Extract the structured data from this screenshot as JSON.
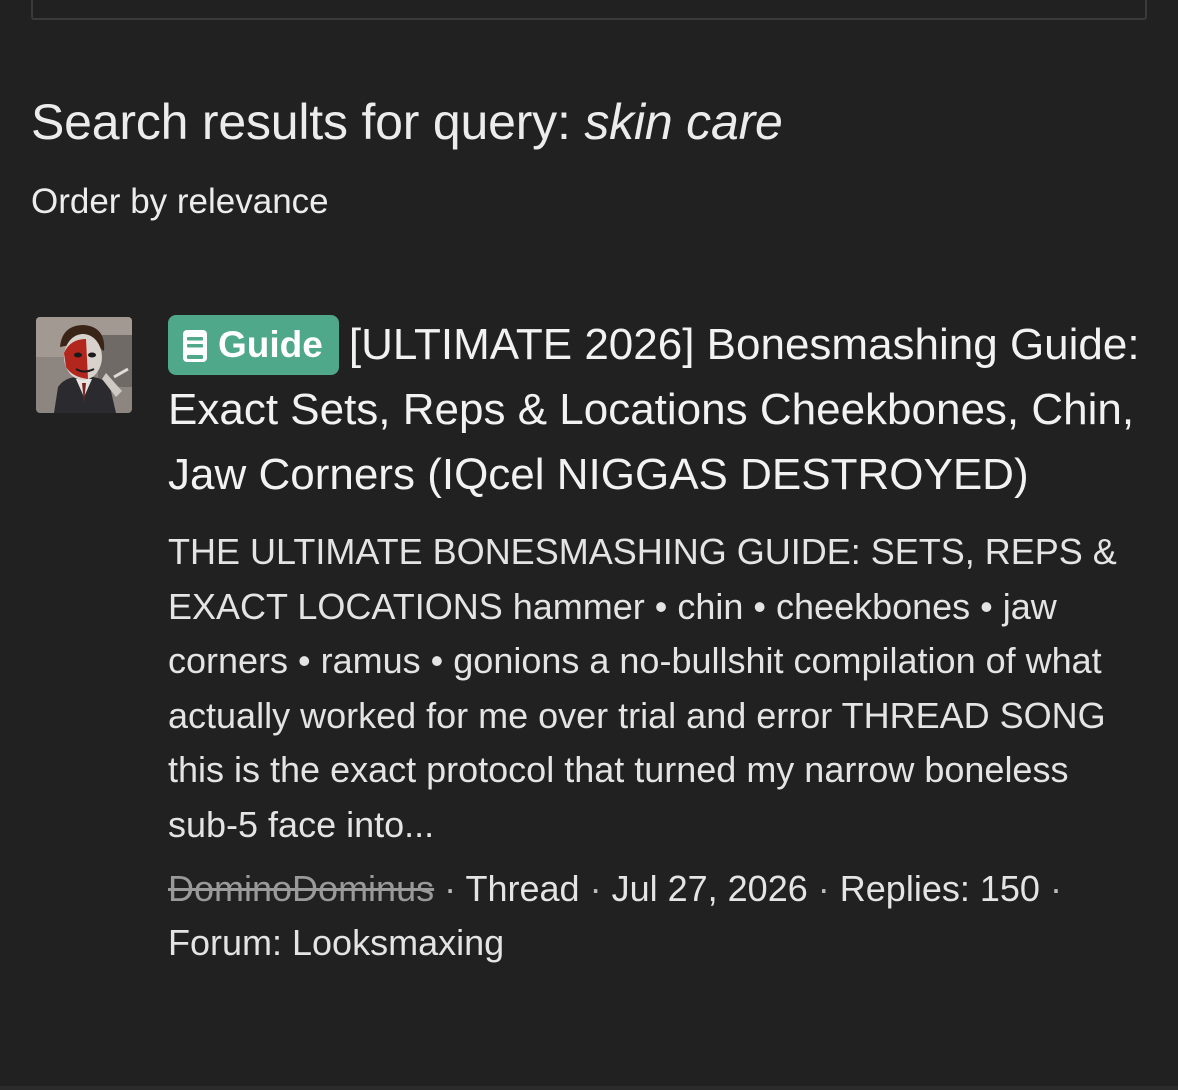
{
  "search": {
    "heading_prefix": "Search results for query: ",
    "query": "skin care",
    "order_label": "Order by relevance"
  },
  "results": [
    {
      "avatar_icon": "user-avatar",
      "prefix_label": "Guide",
      "prefix_icon": "book-icon",
      "prefix_color": "#4fa88a",
      "title": "[ULTIMATE 2026] Bonesmashing Guide: Exact Sets, Reps & Locations Cheekbones, Chin, Jaw Corners (IQcel NIGGAS DESTROYED)",
      "snippet": "THE ULTIMATE BONESMASHING GUIDE: SETS, REPS & EXACT LOCATIONS hammer • chin • cheekbones • jaw corners • ramus • gonions a no-bullshit compilation of what actually worked for me over trial and error THREAD SONG this is the exact protocol that turned my narrow boneless sub-5 face into...",
      "author": "DominoDominus",
      "type": "Thread",
      "date": "Jul 27, 2026",
      "replies": "Replies: 150",
      "forum": "Forum: Looksmaxing"
    }
  ],
  "colors": {
    "background": "#212121",
    "text": "#ececec",
    "muted": "#9a9a9a"
  }
}
